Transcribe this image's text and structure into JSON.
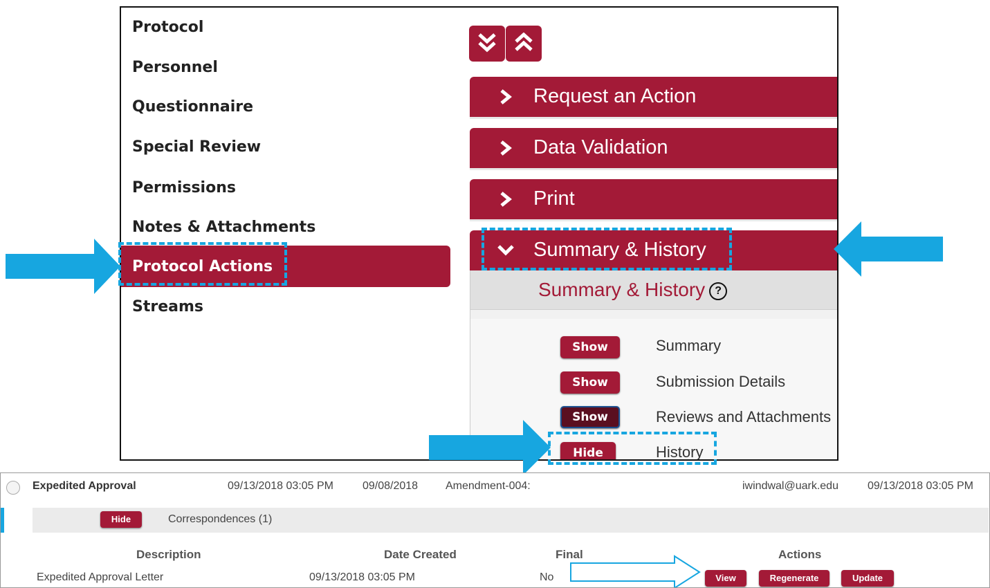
{
  "nav": {
    "items": [
      {
        "label": "Protocol"
      },
      {
        "label": "Personnel"
      },
      {
        "label": "Questionnaire"
      },
      {
        "label": "Special Review"
      },
      {
        "label": "Permissions"
      },
      {
        "label": "Notes & Attachments"
      },
      {
        "label": "Protocol Actions",
        "active": true
      },
      {
        "label": "Streams"
      }
    ]
  },
  "toolbar": {
    "expand_all_icon": "double-chevron-down-icon",
    "collapse_all_icon": "double-chevron-up-icon"
  },
  "sections": [
    {
      "label": "Request an Action",
      "expanded": false
    },
    {
      "label": "Data Validation",
      "expanded": false
    },
    {
      "label": "Print",
      "expanded": false
    },
    {
      "label": "Summary & History",
      "expanded": true
    }
  ],
  "summary_history": {
    "header": "Summary & History",
    "help_icon": "?",
    "rows": [
      {
        "button": "Show",
        "label": "Summary"
      },
      {
        "button": "Show",
        "label": "Submission Details"
      },
      {
        "button": "Show",
        "label": "Reviews and Attachments"
      },
      {
        "button": "Hide",
        "label": "History"
      }
    ]
  },
  "history_row": {
    "action": "Expedited Approval",
    "date1": "09/13/2018 03:05 PM",
    "date2": "09/08/2018",
    "comment": "Amendment-004:",
    "user": "iwindwal@uark.edu",
    "date3": "09/13/2018 03:05 PM",
    "corr_button": "Hide",
    "corr_label": "Correspondences (1)"
  },
  "correspondence_table": {
    "headers": [
      "Description",
      "Date Created",
      "Final",
      "Actions"
    ],
    "row": {
      "description": "Expedited Approval Letter",
      "date_created": "09/13/2018 03:05 PM",
      "final": "No",
      "actions": [
        "View",
        "Regenerate",
        "Update"
      ]
    }
  },
  "colors": {
    "accent": "#a31a37",
    "highlight": "#17a6e0"
  }
}
